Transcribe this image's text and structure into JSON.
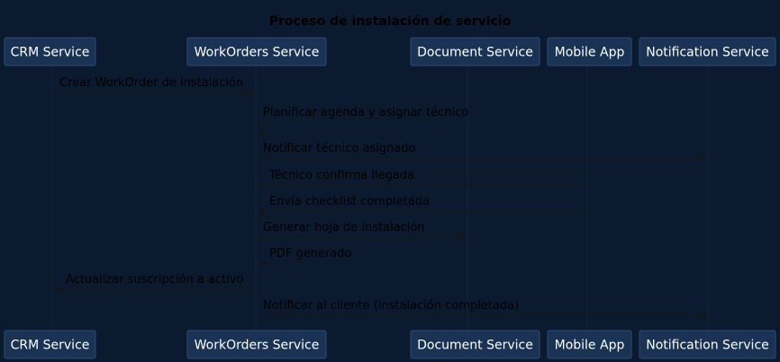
{
  "title": "Proceso de instalación de servicio",
  "participants": [
    {
      "id": "crm",
      "label": "CRM Service"
    },
    {
      "id": "wo",
      "label": "WorkOrders Service"
    },
    {
      "id": "doc",
      "label": "Document Service"
    },
    {
      "id": "mob",
      "label": "Mobile App"
    },
    {
      "id": "notif",
      "label": "Notification Service"
    }
  ],
  "messages": [
    {
      "from": "crm",
      "to": "wo",
      "text": "Crear WorkOrder de instalación",
      "style": "solid"
    },
    {
      "from": "wo",
      "to": "wo",
      "text": "Planificar agenda y asignar técnico",
      "style": "solid"
    },
    {
      "from": "wo",
      "to": "notif",
      "text": "Notificar técnico asignado",
      "style": "solid"
    },
    {
      "from": "mob",
      "to": "wo",
      "text": "Técnico confirma llegada",
      "style": "solid"
    },
    {
      "from": "mob",
      "to": "wo",
      "text": "Envía checklist completada",
      "style": "solid"
    },
    {
      "from": "wo",
      "to": "doc",
      "text": "Generar hoja de instalación",
      "style": "solid"
    },
    {
      "from": "doc",
      "to": "wo",
      "text": "PDF generado",
      "style": "dashed"
    },
    {
      "from": "wo",
      "to": "crm",
      "text": "Actualizar suscripción a activo",
      "style": "solid"
    },
    {
      "from": "wo",
      "to": "notif",
      "text": "Notificar al cliente (instalación completada)",
      "style": "solid"
    }
  ],
  "colors": {
    "background": "#0b1a2e",
    "box_fill": "#1a3354",
    "box_border": "#2c4c73",
    "box_text": "#ffffff",
    "arrow": "#161616",
    "label": "#000000"
  }
}
